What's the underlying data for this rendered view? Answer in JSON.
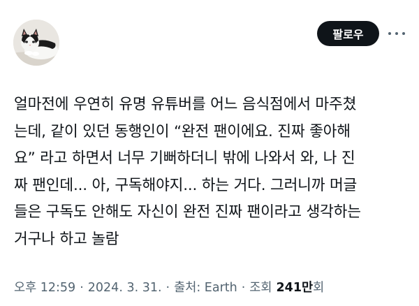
{
  "header": {
    "follow_label": "팔로우",
    "more_icon": "more-horizontal-icon",
    "avatar_icon": "cat-avatar"
  },
  "post": {
    "lines": [
      "얼마전에 우연히 유명 유튜버를 어느 음식점에서 마주쳤",
      "는데, 같이 있던 동행인이 “완전 팬이에요. 진짜 좋아해",
      "요” 라고 하면서 너무 기뻐하더니 밖에 나와서 와, 나 진",
      "짜 팬인데... 아, 구독해야지... 하는 거다. 그러니까 머글",
      "들은 구독도 안해도 자신이 완전 진짜 팬이라고 생각하는",
      "거구나 하고 놀람"
    ]
  },
  "meta": {
    "time": "오후 12:59",
    "separator": "·",
    "date": "2024. 3. 31.",
    "source": "출처: Earth",
    "views_label": "조회",
    "views_count": "241만",
    "views_suffix": "회"
  },
  "colors": {
    "text": "#0f1419",
    "secondary": "#536471",
    "button_bg": "#0f1419"
  }
}
